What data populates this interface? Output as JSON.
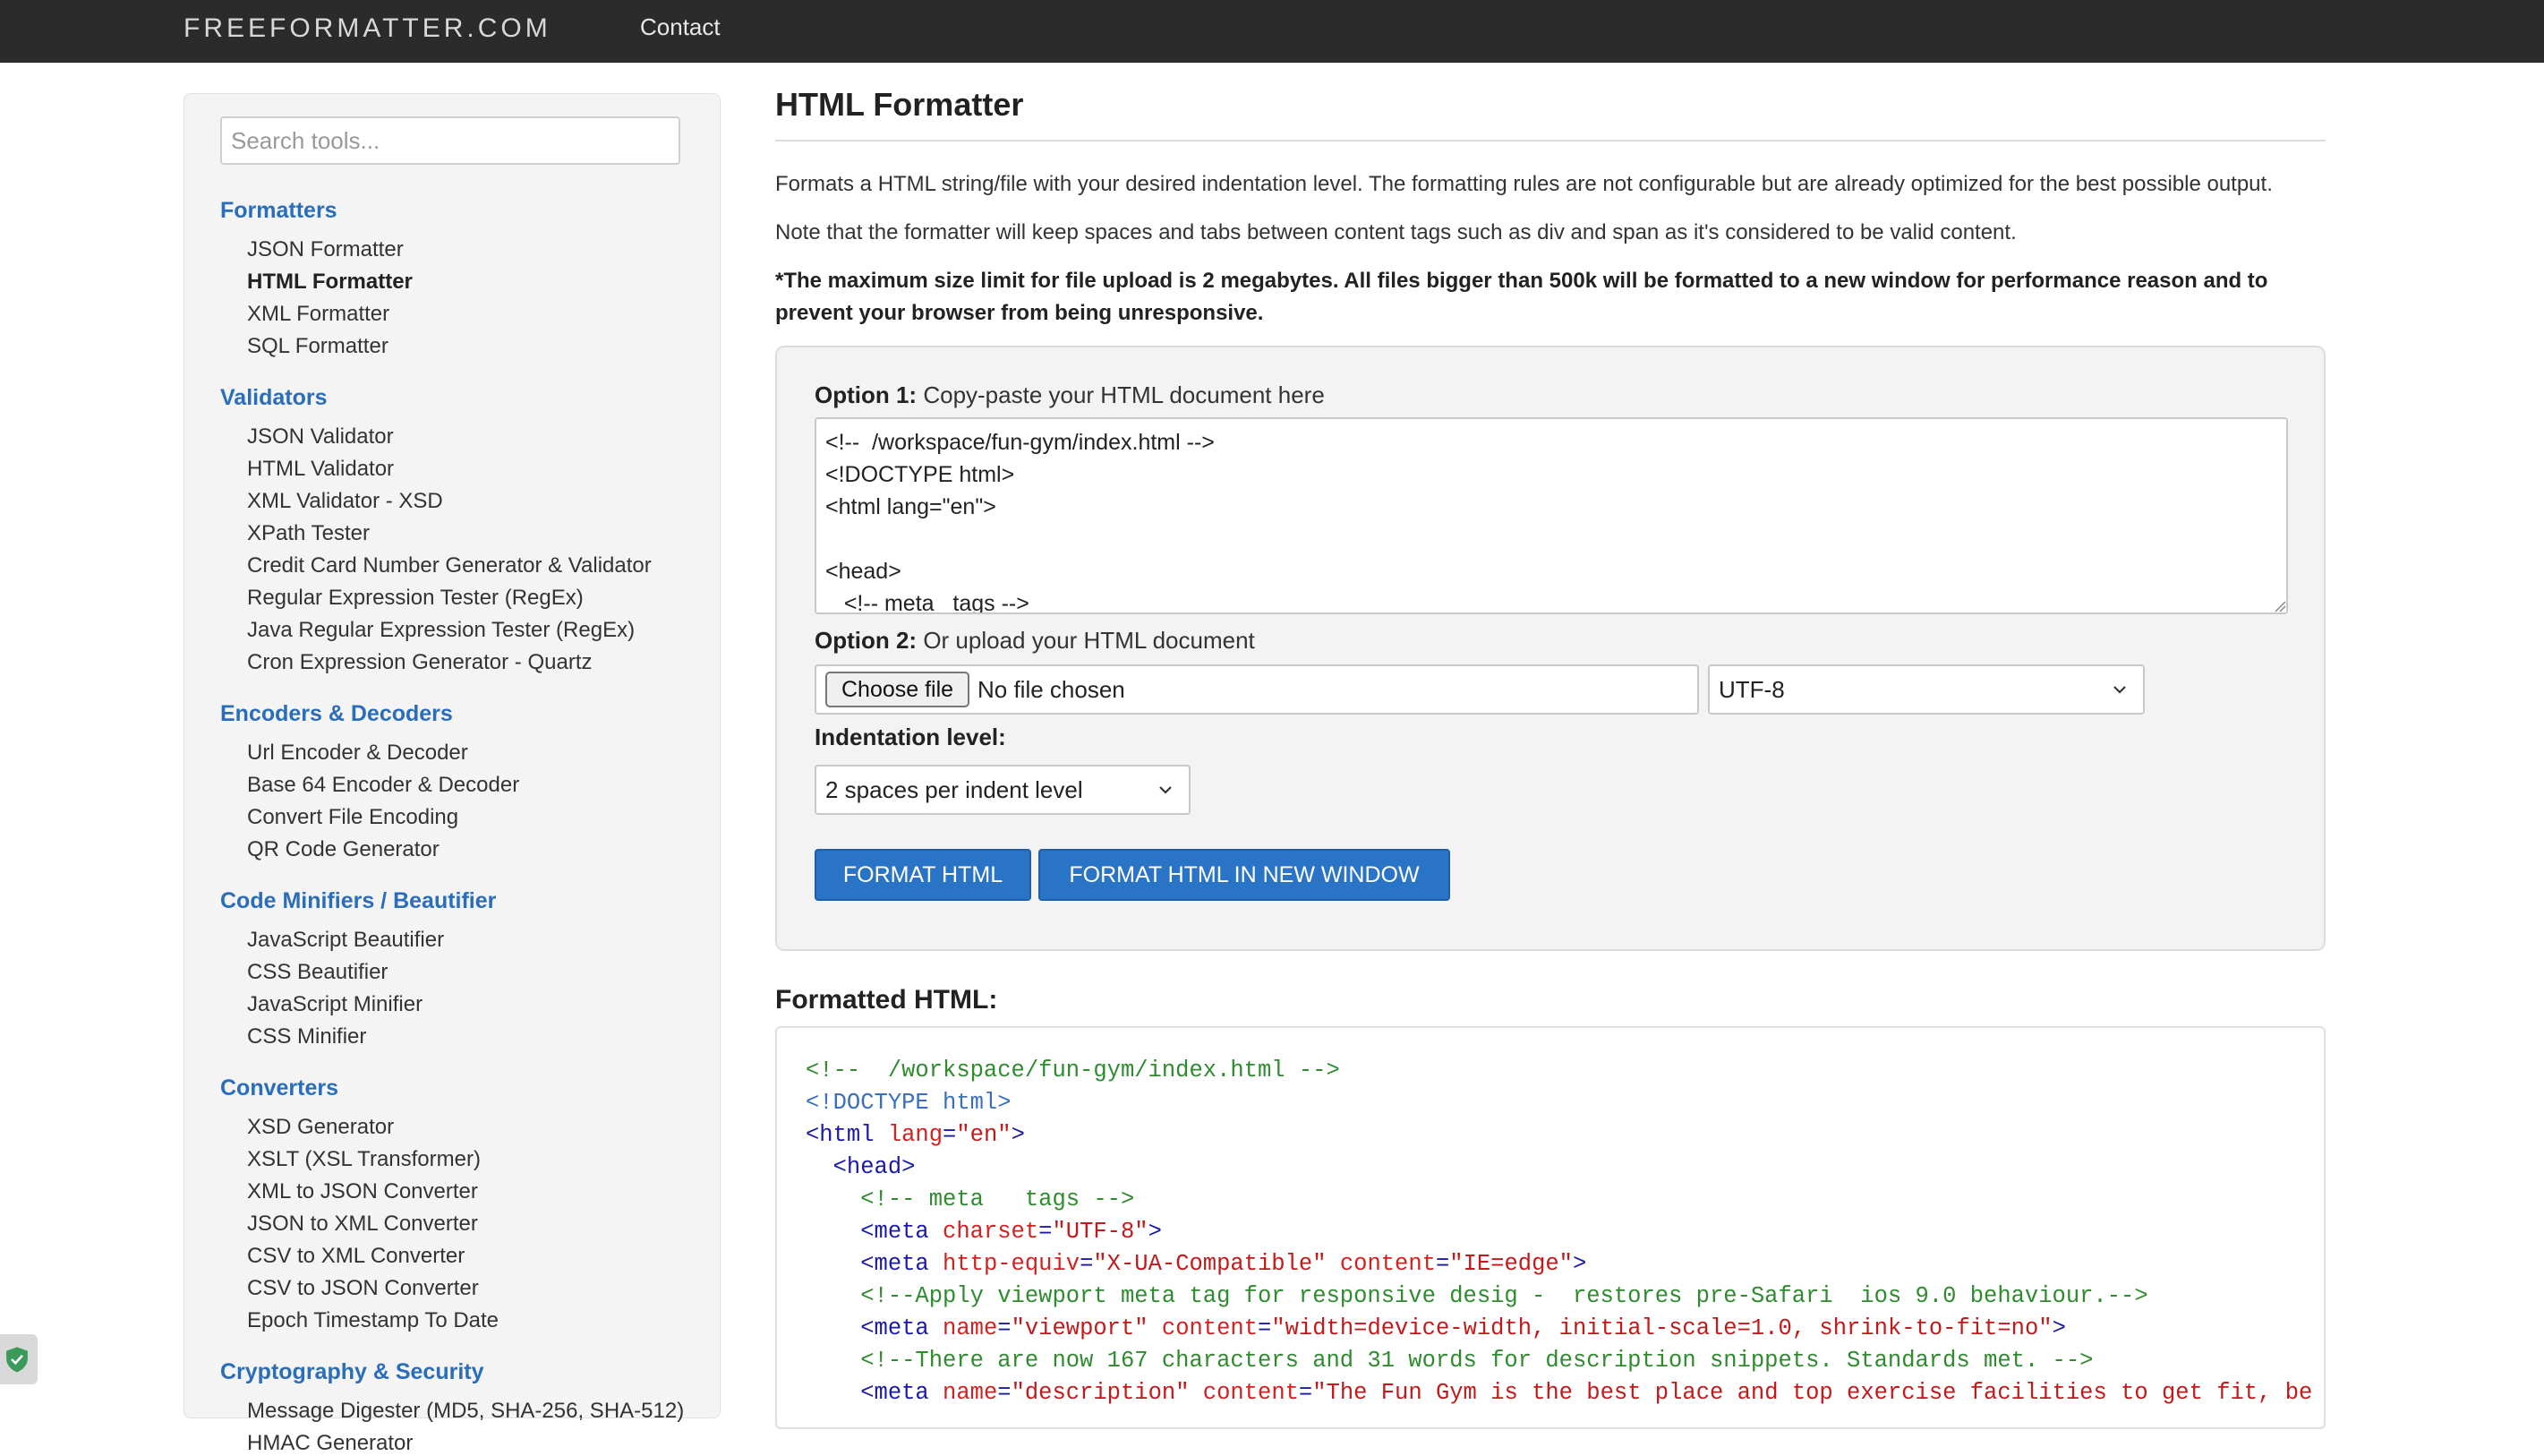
{
  "topbar": {
    "brand": "FREEFORMATTER.COM",
    "contact": "Contact"
  },
  "sidebar": {
    "search_placeholder": "Search tools...",
    "categories": [
      {
        "title": "Formatters",
        "items": [
          "JSON Formatter",
          "HTML Formatter",
          "XML Formatter",
          "SQL Formatter"
        ]
      },
      {
        "title": "Validators",
        "items": [
          "JSON Validator",
          "HTML Validator",
          "XML Validator - XSD",
          "XPath Tester",
          "Credit Card Number Generator & Validator",
          "Regular Expression Tester (RegEx)",
          "Java Regular Expression Tester (RegEx)",
          "Cron Expression Generator - Quartz"
        ]
      },
      {
        "title": "Encoders & Decoders",
        "items": [
          "Url Encoder & Decoder",
          "Base 64 Encoder & Decoder",
          "Convert File Encoding",
          "QR Code Generator"
        ]
      },
      {
        "title": "Code Minifiers / Beautifier",
        "items": [
          "JavaScript Beautifier",
          "CSS Beautifier",
          "JavaScript Minifier",
          "CSS Minifier"
        ]
      },
      {
        "title": "Converters",
        "items": [
          "XSD Generator",
          "XSLT (XSL Transformer)",
          "XML to JSON Converter",
          "JSON to XML Converter",
          "CSV to XML Converter",
          "CSV to JSON Converter",
          "Epoch Timestamp To Date"
        ]
      },
      {
        "title": "Cryptography & Security",
        "items": [
          "Message Digester (MD5, SHA-256, SHA-512)",
          "HMAC Generator"
        ]
      }
    ],
    "active_item": "HTML Formatter"
  },
  "main": {
    "title": "HTML Formatter",
    "desc1": "Formats a HTML string/file with your desired indentation level. The formatting rules are not configurable but are already optimized for the best possible output.",
    "desc2": "Note that the formatter will keep spaces and tabs between content tags such as div and span as it's considered to be valid content.",
    "desc3": "*The maximum size limit for file upload is 2 megabytes. All files bigger than 500k will be formatted to a new window for performance reason and to prevent your browser from being unresponsive.",
    "option1_label": "Option 1:",
    "option1_text": "Copy-paste your HTML document here",
    "textarea_value": "<!--  /workspace/fun-gym/index.html -->\n<!DOCTYPE html>\n<html lang=\"en\">\n\n<head>\n   <!-- meta   tags -->",
    "option2_label": "Option 2:",
    "option2_text": "Or upload your HTML document",
    "choose_file": "Choose file",
    "no_file": "No file chosen",
    "encoding": "UTF-8",
    "indent_label": "Indentation level:",
    "indent_value": "2 spaces per indent level",
    "format_button": "FORMAT HTML",
    "format_new_window_button": "FORMAT HTML IN NEW WINDOW",
    "output_title": "Formatted HTML:",
    "code_lines": [
      [
        {
          "t": "<!--  /workspace/fun-gym/index.html -->",
          "c": "com"
        }
      ],
      [
        {
          "t": "<!DOCTYPE html>",
          "c": "doc"
        }
      ],
      [
        {
          "t": "<html",
          "c": "tag"
        },
        {
          "t": " lang",
          "c": "attr"
        },
        {
          "t": "=",
          "c": "punc"
        },
        {
          "t": "\"en\"",
          "c": "val"
        },
        {
          "t": ">",
          "c": "tag"
        }
      ],
      [
        {
          "t": "  <head>",
          "c": "tag"
        }
      ],
      [
        {
          "t": "    <!-- meta   tags -->",
          "c": "com"
        }
      ],
      [
        {
          "t": "    <meta",
          "c": "tag"
        },
        {
          "t": " charset",
          "c": "attr"
        },
        {
          "t": "=",
          "c": "punc"
        },
        {
          "t": "\"UTF-8\"",
          "c": "val"
        },
        {
          "t": ">",
          "c": "tag"
        }
      ],
      [
        {
          "t": "    <meta",
          "c": "tag"
        },
        {
          "t": " http-equiv",
          "c": "attr"
        },
        {
          "t": "=",
          "c": "punc"
        },
        {
          "t": "\"X-UA-Compatible\"",
          "c": "val"
        },
        {
          "t": " content",
          "c": "attr"
        },
        {
          "t": "=",
          "c": "punc"
        },
        {
          "t": "\"IE=edge\"",
          "c": "val"
        },
        {
          "t": ">",
          "c": "tag"
        }
      ],
      [
        {
          "t": "    <!--Apply viewport meta tag for responsive desig -  restores pre-Safari  ios 9.0 behaviour.-->",
          "c": "com"
        }
      ],
      [
        {
          "t": "    <meta",
          "c": "tag"
        },
        {
          "t": " name",
          "c": "attr"
        },
        {
          "t": "=",
          "c": "punc"
        },
        {
          "t": "\"viewport\"",
          "c": "val"
        },
        {
          "t": " content",
          "c": "attr"
        },
        {
          "t": "=",
          "c": "punc"
        },
        {
          "t": "\"width=device-width, initial-scale=1.0, shrink-to-fit=no\"",
          "c": "val"
        },
        {
          "t": ">",
          "c": "tag"
        }
      ],
      [
        {
          "t": "    <!--There are now 167 characters and 31 words for description snippets. Standards met. -->",
          "c": "com"
        }
      ],
      [
        {
          "t": "    <meta",
          "c": "tag"
        },
        {
          "t": " name",
          "c": "attr"
        },
        {
          "t": "=",
          "c": "punc"
        },
        {
          "t": "\"description\"",
          "c": "val"
        },
        {
          "t": " content",
          "c": "attr"
        },
        {
          "t": "=",
          "c": "punc"
        },
        {
          "t": "\"The Fun Gym is the best place and top exercise facilities to get fit, be happy,",
          "c": "val"
        }
      ]
    ]
  }
}
